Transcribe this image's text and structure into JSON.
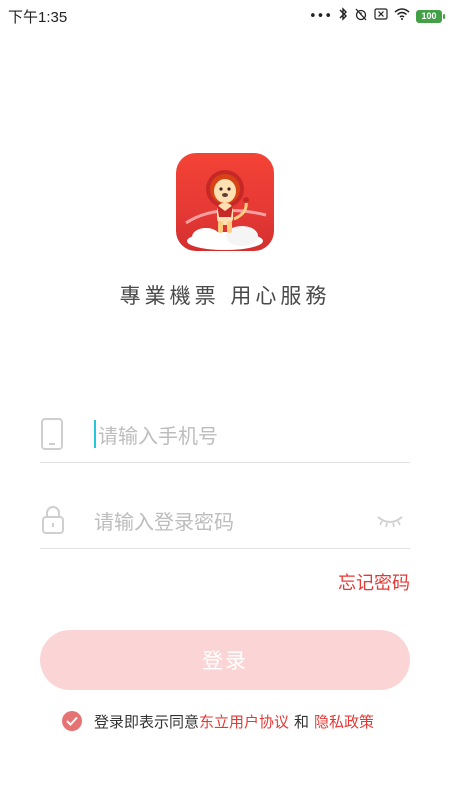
{
  "status_bar": {
    "time": "下午1:35",
    "icons": [
      "more-dots-icon",
      "bluetooth-icon",
      "alarm-off-icon",
      "close-box-icon",
      "wifi-icon"
    ],
    "battery": "100",
    "battery_color": "#43a047"
  },
  "app": {
    "logo_icon": "lion-mascot-logo",
    "tagline": "專業機票 用心服務"
  },
  "form": {
    "phone_placeholder": "请输入手机号",
    "password_placeholder": "请输入登录密码",
    "forgot_password": "忘记密码",
    "login_button": "登录"
  },
  "agreement": {
    "prefix": "登录即表示同意",
    "user_agreement": "东立用户协议",
    "conjunction": "和",
    "privacy_policy": "隐私政策",
    "checked": true
  },
  "colors": {
    "accent": "#e53935",
    "button_disabled": "#fbd5d5",
    "caret": "#26c6da"
  }
}
